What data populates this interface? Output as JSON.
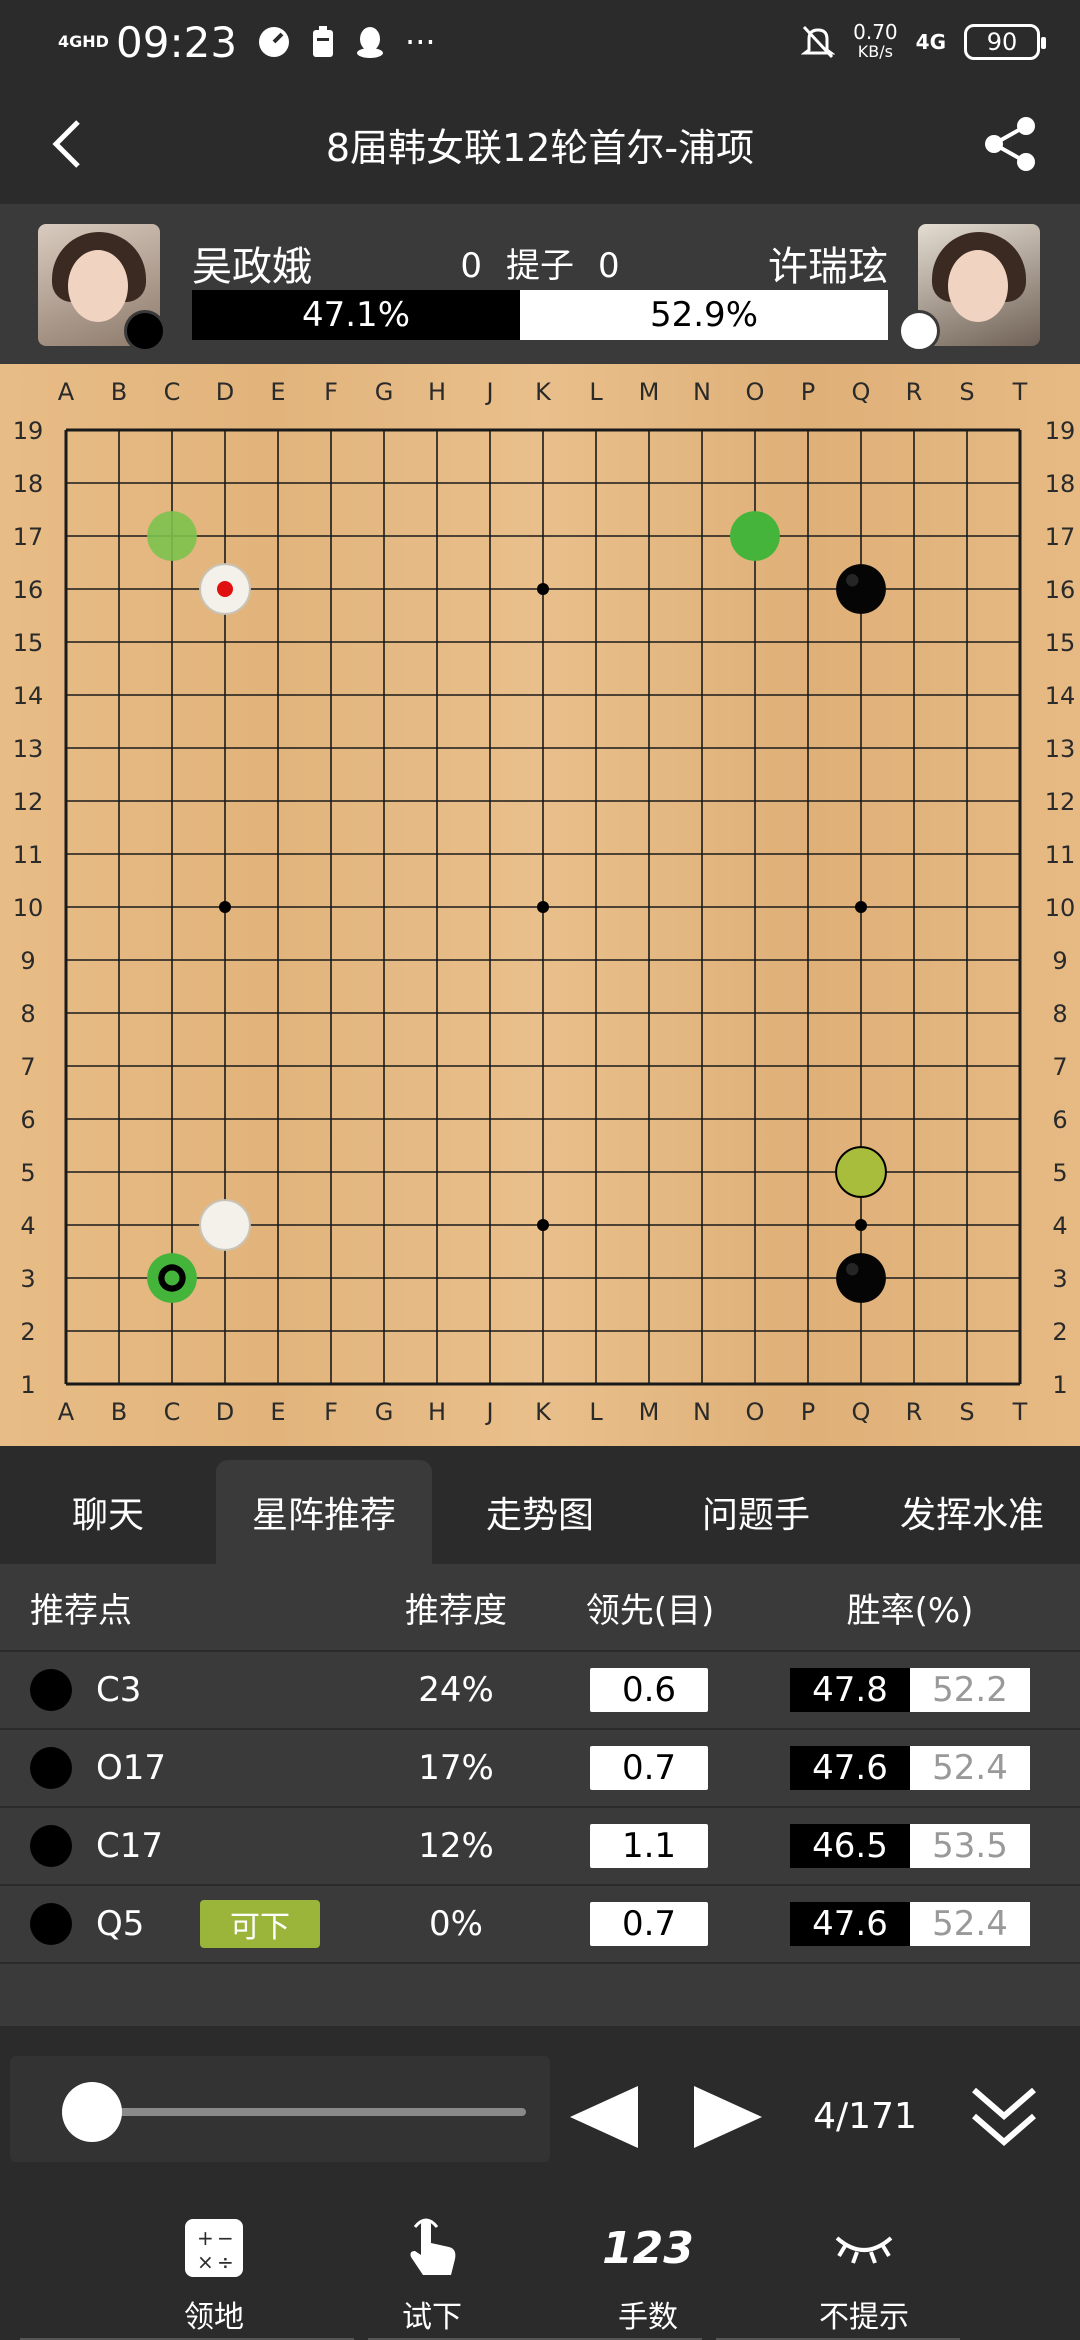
{
  "statusbar": {
    "network": "4GHD",
    "time": "09:23",
    "speed": "0.70",
    "speed_unit": "KB/s",
    "net_type": "4G",
    "battery": "90"
  },
  "header": {
    "title": "8届韩女联12轮首尔-浦项"
  },
  "players": {
    "black_name": "吴政娥",
    "white_name": "许瑞玹",
    "black_captures": "0",
    "white_captures": "0",
    "captures_label": "提子",
    "black_winrate": "47.1%",
    "white_winrate": "52.9%",
    "black_fraction": 0.471
  },
  "board": {
    "size": 19,
    "columns": [
      "A",
      "B",
      "C",
      "D",
      "E",
      "F",
      "G",
      "H",
      "J",
      "K",
      "L",
      "M",
      "N",
      "O",
      "P",
      "Q",
      "R",
      "S",
      "T"
    ],
    "rows": [
      "19",
      "18",
      "17",
      "16",
      "15",
      "14",
      "13",
      "12",
      "11",
      "10",
      "9",
      "8",
      "7",
      "6",
      "5",
      "4",
      "3",
      "2",
      "1"
    ],
    "stones": [
      {
        "point": "Q16",
        "color": "black"
      },
      {
        "point": "Q3",
        "color": "black"
      },
      {
        "point": "D16",
        "color": "white",
        "last_move": true
      },
      {
        "point": "D4",
        "color": "white"
      }
    ],
    "suggestions": [
      {
        "point": "C3",
        "style": "best"
      },
      {
        "point": "O17",
        "style": "green"
      },
      {
        "point": "C17",
        "style": "light-green"
      },
      {
        "point": "Q5",
        "style": "olive"
      }
    ],
    "colors": {
      "board": "#e6b981",
      "suggest_green": "#44b43a",
      "suggest_light": "#7cc24e",
      "suggest_olive": "#a9bd3c"
    }
  },
  "tabs": [
    {
      "label": "聊天",
      "active": false
    },
    {
      "label": "星阵推荐",
      "active": true
    },
    {
      "label": "走势图",
      "active": false
    },
    {
      "label": "问题手",
      "active": false
    },
    {
      "label": "发挥水准",
      "active": false
    }
  ],
  "table": {
    "headers": {
      "point": "推荐点",
      "recommend": "推荐度",
      "lead": "领先(目)",
      "winrate": "胜率(%)"
    },
    "rows": [
      {
        "point": "C3",
        "badge": "",
        "recommend": "24%",
        "lead": "0.6",
        "black": "47.8",
        "white": "52.2"
      },
      {
        "point": "O17",
        "badge": "",
        "recommend": "17%",
        "lead": "0.7",
        "black": "47.6",
        "white": "52.4"
      },
      {
        "point": "C17",
        "badge": "",
        "recommend": "12%",
        "lead": "1.1",
        "black": "46.5",
        "white": "53.5"
      },
      {
        "point": "Q5",
        "badge": "可下",
        "recommend": "0%",
        "lead": "0.7",
        "black": "47.6",
        "white": "52.4"
      }
    ]
  },
  "controls": {
    "move_counter": "4/171",
    "progress": 0.023
  },
  "toolbar": {
    "territory": "领地",
    "try_move": "试下",
    "move_numbers": "手数",
    "move_numbers_icon_text": "123",
    "no_hint": "不提示"
  }
}
